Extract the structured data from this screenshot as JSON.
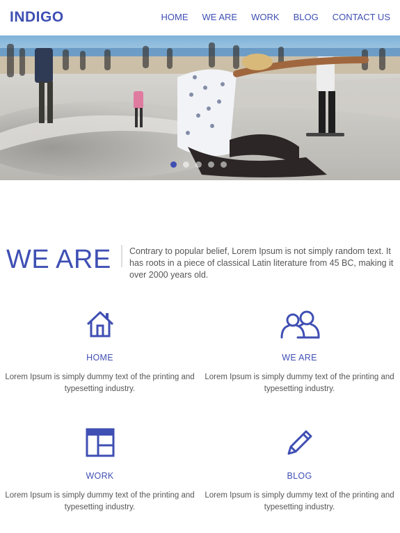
{
  "header": {
    "logo": "INDIGO",
    "nav": [
      "HOME",
      "WE ARE",
      "WORK",
      "BLOG",
      "CONTACT US"
    ]
  },
  "hero": {
    "slide_count": 5,
    "active_slide": 1
  },
  "weare": {
    "title": "WE ARE",
    "text": "Contrary to popular belief, Lorem Ipsum is not simply random text. It has roots in a piece of classical Latin literature from 45 BC, making it over 2000 years old."
  },
  "features": [
    {
      "icon": "home-icon",
      "title": "HOME",
      "text": "Lorem Ipsum is simply dummy text of the printing and typesetting industry."
    },
    {
      "icon": "users-icon",
      "title": "WE ARE",
      "text": "Lorem Ipsum is simply dummy text of the printing and typesetting industry."
    },
    {
      "icon": "layout-icon",
      "title": "WORK",
      "text": "Lorem Ipsum is simply dummy text of the printing and typesetting industry."
    },
    {
      "icon": "pencil-icon",
      "title": "BLOG",
      "text": "Lorem Ipsum is simply dummy text of the printing and typesetting industry."
    }
  ],
  "colors": {
    "accent": "#3f4fb3",
    "text": "#555555",
    "background": "#ffffff"
  }
}
